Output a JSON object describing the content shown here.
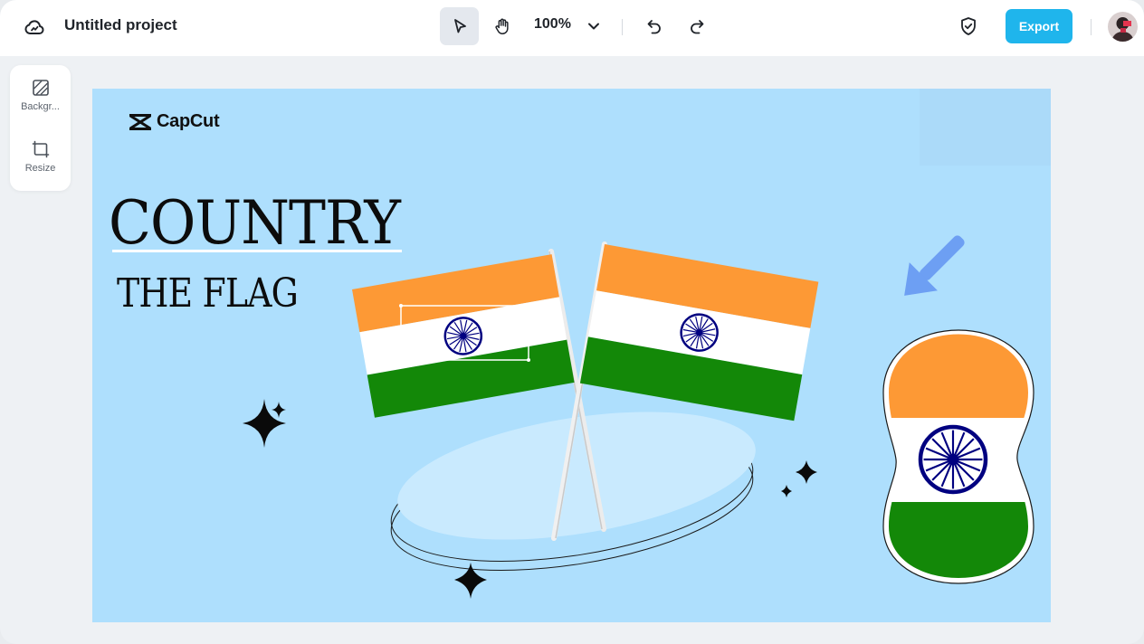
{
  "topbar": {
    "logo_icon": "cloud-icon",
    "project_title": "Untitled project",
    "select_tool_icon": "pointer-icon",
    "hand_tool_icon": "hand-icon",
    "zoom_level": "100%",
    "zoom_dropdown_icon": "chevron-down-icon",
    "undo_icon": "undo-icon",
    "redo_icon": "redo-icon",
    "shield_icon": "shield-check-icon",
    "export_label": "Export",
    "avatar_icon": "user-avatar"
  },
  "sidepanel": {
    "items": [
      {
        "label": "Backgr...",
        "icon": "background-icon"
      },
      {
        "label": "Resize",
        "icon": "resize-icon"
      }
    ]
  },
  "canvas": {
    "background_color": "#aedffd",
    "logo_text": "CapCut",
    "headline": "COUNTRY",
    "subline": "THE FLAG",
    "flag_colors": {
      "saffron": "#fd9935",
      "white": "#ffffff",
      "green": "#138808",
      "chakra": "#000080"
    },
    "arrow_color": "#6d9ff3"
  },
  "colors": {
    "accent": "#1fb5ec",
    "topbar": "#ffffff",
    "workspace": "#eef1f4"
  }
}
